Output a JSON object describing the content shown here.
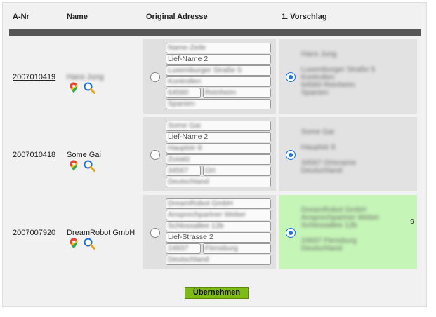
{
  "header": {
    "col_anr": "A-Nr",
    "col_name": "Name",
    "col_address": "Original Adresse",
    "col_proposal": "1. Vorschlag"
  },
  "rows": [
    {
      "anr": "2007010419",
      "name": "Hans Jung",
      "name_blurred": true,
      "orig_fields": [
        "Name-Zeile",
        "Lief-Name 2",
        "Luxemburger Straße 5",
        "Kontrollen",
        "64560",
        "Reinheim",
        "Spanien"
      ],
      "orig_blurred": [
        true,
        false,
        true,
        true,
        true,
        true,
        true
      ],
      "orig_selected": false,
      "proposal_lines": [
        "Hans Jung",
        "",
        "Luxemburger Straße 5",
        "Kontrollen",
        "64560 Reinheim",
        "Spanien"
      ],
      "proposal_selected": true,
      "proposal_highlight": false
    },
    {
      "anr": "2007010418",
      "name": "Some Gai",
      "name_blurred": false,
      "orig_fields": [
        "Some Gai",
        "Lief-Name 2",
        "Hauptstr 8",
        "Zusatz",
        "34567",
        "Ort",
        "Deutschland"
      ],
      "orig_blurred": [
        true,
        false,
        true,
        true,
        true,
        true,
        true
      ],
      "orig_selected": false,
      "proposal_lines": [
        "Some Gai",
        "",
        "Hauptstr 8",
        "",
        "34567 Ortsname",
        "Deutschland"
      ],
      "proposal_selected": true,
      "proposal_highlight": false
    },
    {
      "anr": "2007007920",
      "name": "DreamRobot GmbH",
      "name_blurred": false,
      "orig_fields": [
        "DreamRobot GmbH",
        "Ansprechpartner Weber",
        "Schlossallee 12b",
        "Lief-Strasse 2",
        "24937",
        "Flensburg",
        "Deutschland"
      ],
      "orig_blurred": [
        true,
        true,
        true,
        false,
        true,
        true,
        true
      ],
      "orig_selected": false,
      "proposal_lines": [
        "DreamRobot GmbH",
        "Ansprechpartner Weber",
        "Schlossallee 12b",
        "",
        "24937 Flensburg",
        "Deutschland"
      ],
      "proposal_end_char": "9",
      "proposal_selected": true,
      "proposal_highlight": true
    }
  ],
  "icons": {
    "maps": "google-maps-pin-icon",
    "search": "magnifier-search-icon"
  },
  "colors": {
    "bar": "#555555",
    "submit": "#7fbb14",
    "highlight": "#c6f5b8",
    "radio": "#1a73e8"
  },
  "submit_label": "Übernehmen"
}
